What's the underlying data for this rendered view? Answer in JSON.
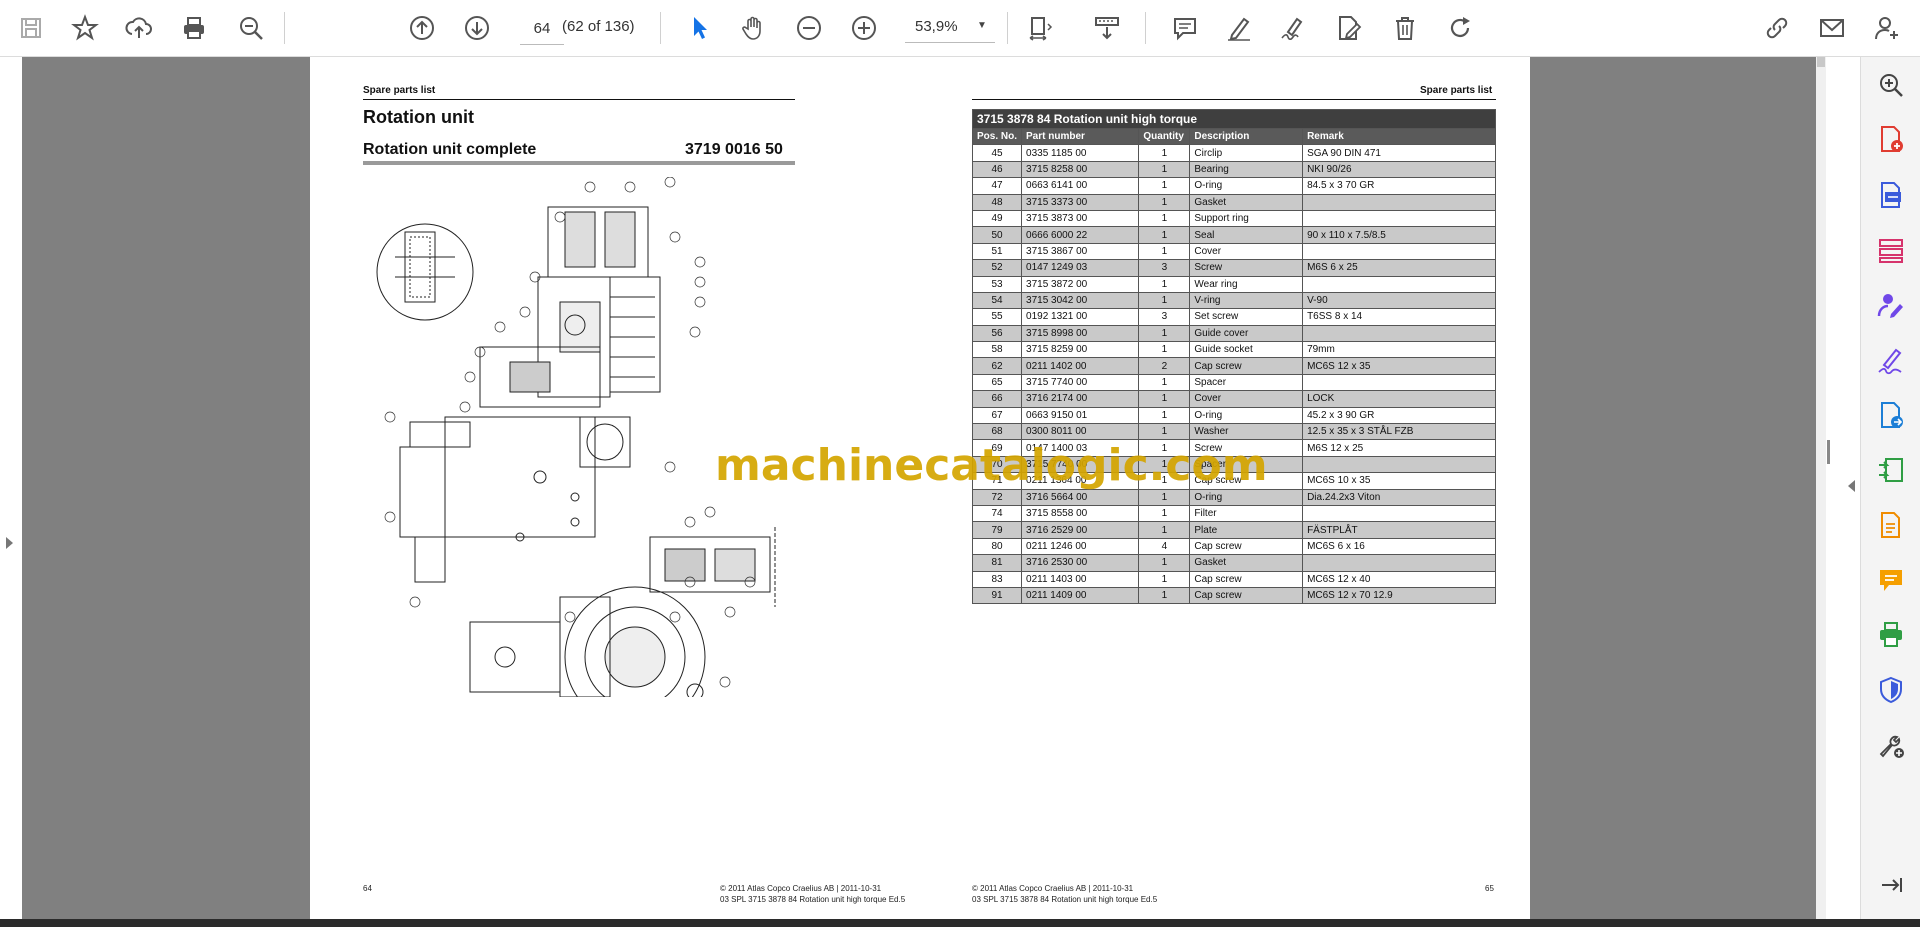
{
  "toolbar": {
    "page_current": "64",
    "page_count": "(62 of 136)",
    "zoom": "53,9%",
    "icons": [
      "save-icon",
      "bookmark-star-icon",
      "upload-icon",
      "print-icon",
      "zoom-search-icon",
      "page-up-icon",
      "page-down-icon",
      "select-arrow-icon",
      "hand-tool-icon",
      "zoom-out-icon",
      "zoom-in-icon",
      "fit-page-icon",
      "scroll-mode-icon",
      "comment-icon",
      "pen-icon",
      "sign-icon",
      "edit-pdf-icon",
      "delete-icon",
      "rotate-icon",
      "share-link-icon",
      "email-icon",
      "account-icon"
    ]
  },
  "right_panel": {
    "icons": [
      "zoom-panel-icon",
      "create-pdf-icon",
      "export-pdf-icon",
      "organize-pages-icon",
      "request-signature-icon",
      "fill-sign-icon",
      "export-doc-icon",
      "compress-icon",
      "edit-doc-icon",
      "comment-panel-icon",
      "print-production-icon",
      "protect-icon",
      "more-tools-icon",
      "collapse-panel-icon"
    ]
  },
  "left_page": {
    "header": "Spare parts list",
    "title": "Rotation unit",
    "subtitle": "Rotation unit complete",
    "part_number": "3719 0016 50",
    "page_number": "64",
    "footer_line1": "© 2011 Atlas Copco Craelius AB | 2011-10-31",
    "footer_line2": "03 SPL 3715 3878 84 Rotation unit high torque Ed.5"
  },
  "right_page": {
    "header": "Spare parts list",
    "table_caption": "3715 3878 84    Rotation unit high torque",
    "columns": [
      "Pos. No.",
      "Part number",
      "Quantity",
      "Description",
      "Remark"
    ],
    "rows": [
      [
        "45",
        "0335 1185 00",
        "1",
        "Circlip",
        "SGA 90 DIN 471"
      ],
      [
        "46",
        "3715 8258 00",
        "1",
        "Bearing",
        "NKI 90/26"
      ],
      [
        "47",
        "0663 6141 00",
        "1",
        "O-ring",
        "84.5 x 3     70 GR"
      ],
      [
        "48",
        "3715 3373 00",
        "1",
        "Gasket",
        ""
      ],
      [
        "49",
        "3715 3873 00",
        "1",
        "Support ring",
        ""
      ],
      [
        "50",
        "0666 6000 22",
        "1",
        "Seal",
        "90 x 110 x 7.5/8.5"
      ],
      [
        "51",
        "3715 3867 00",
        "1",
        "Cover",
        ""
      ],
      [
        "52",
        "0147 1249 03",
        "3",
        "Screw",
        "M6S 6 x 25"
      ],
      [
        "53",
        "3715 3872 00",
        "1",
        "Wear ring",
        ""
      ],
      [
        "54",
        "3715 3042 00",
        "1",
        "V-ring",
        "V-90"
      ],
      [
        "55",
        "0192 1321 00",
        "3",
        "Set screw",
        "T6SS 8 x 14"
      ],
      [
        "56",
        "3715 8998 00",
        "1",
        "Guide cover",
        ""
      ],
      [
        "58",
        "3715 8259 00",
        "1",
        "Guide socket",
        "79mm"
      ],
      [
        "62",
        "0211 1402 00",
        "2",
        "Cap screw",
        "MC6S 12 x 35"
      ],
      [
        "65",
        "3715 7740 00",
        "1",
        "Spacer",
        ""
      ],
      [
        "66",
        "3716 2174 00",
        "1",
        "Cover",
        "LOCK"
      ],
      [
        "67",
        "0663 9150 01",
        "1",
        "O-ring",
        "45.2 x 3  90 GR"
      ],
      [
        "68",
        "0300 8011 00",
        "1",
        "Washer",
        "12.5 x 35 x 3 STÅL FZB"
      ],
      [
        "69",
        "0147 1400 03",
        "1",
        "Screw",
        "M6S 12 x 25"
      ],
      [
        "70",
        "3715 7740 00",
        "1",
        "Spacer",
        ""
      ],
      [
        "71",
        "0211 1364 00",
        "1",
        "Cap screw",
        "MC6S 10 x 35"
      ],
      [
        "72",
        "3716 5664 00",
        "1",
        "O-ring",
        "Dia.24.2x3 Viton"
      ],
      [
        "74",
        "3715 8558 00",
        "1",
        "Filter",
        ""
      ],
      [
        "79",
        "3716 2529 00",
        "1",
        "Plate",
        "FÄSTPLÅT"
      ],
      [
        "80",
        "0211 1246 00",
        "4",
        "Cap screw",
        "MC6S 6 x 16"
      ],
      [
        "81",
        "3716 2530 00",
        "1",
        "Gasket",
        ""
      ],
      [
        "83",
        "0211 1403 00",
        "1",
        "Cap screw",
        "MC6S 12 x 40"
      ],
      [
        "91",
        "0211 1409 00",
        "1",
        "Cap screw",
        "MC6S 12 x 70 12.9"
      ]
    ],
    "page_number": "65",
    "footer_line1": "© 2011 Atlas Copco Craelius AB | 2011-10-31",
    "footer_line2": "03 SPL 3715 3878 84 Rotation unit high torque Ed.5"
  },
  "watermark": "machinecatalogic.com"
}
